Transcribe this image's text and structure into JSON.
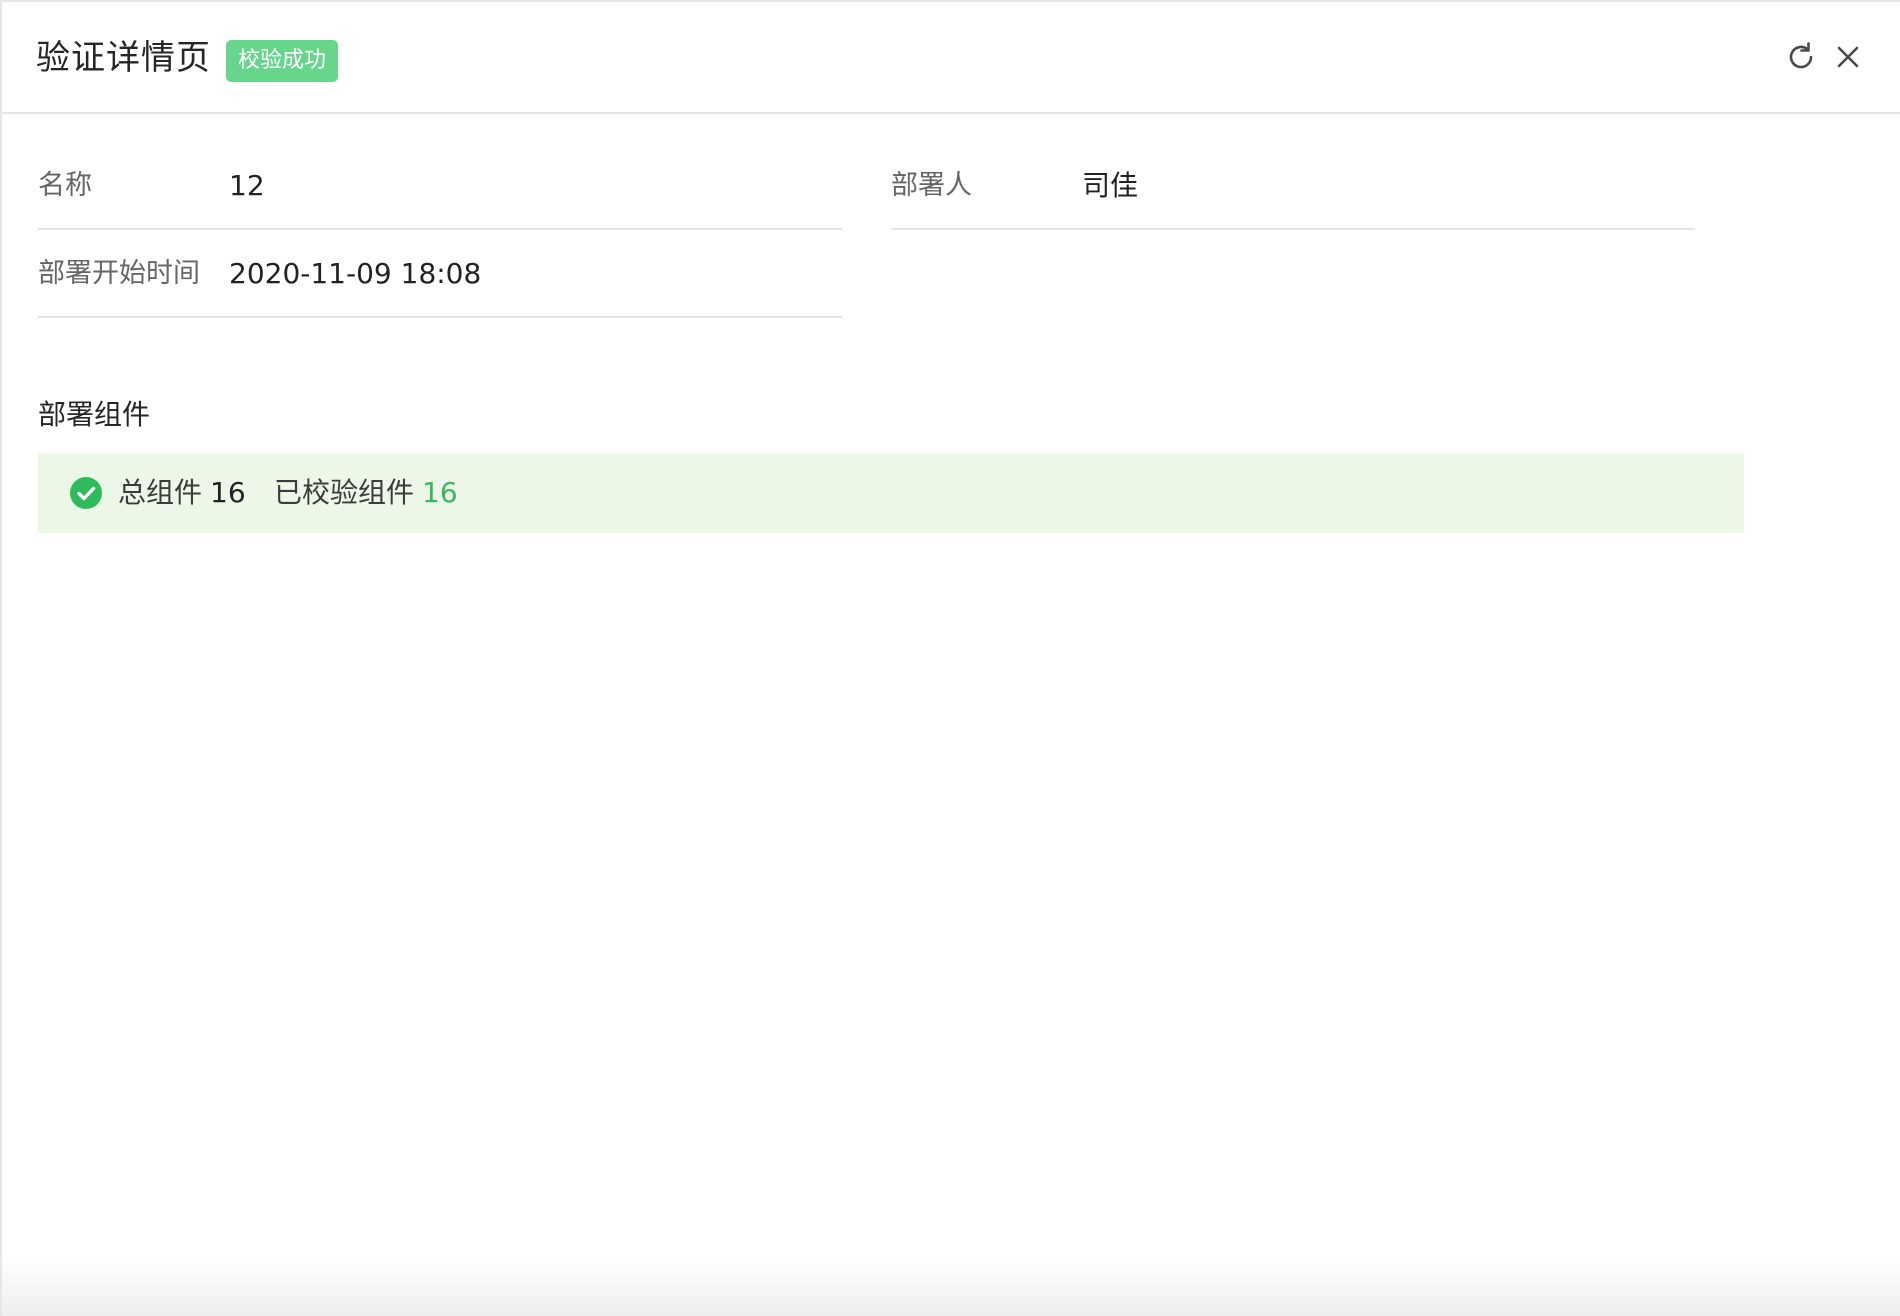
{
  "header": {
    "title": "验证详情页",
    "status_badge": "校验成功",
    "refresh_icon": "refresh-icon",
    "close_icon": "close-icon"
  },
  "fields": {
    "name": {
      "label": "名称",
      "value": "12"
    },
    "deployer": {
      "label": "部署人",
      "value": "司佳"
    },
    "start_time": {
      "label": "部署开始时间",
      "value": "2020-11-09 18:08"
    }
  },
  "components": {
    "section_title": "部署组件",
    "status_icon": "check-circle-icon",
    "total_label": "总组件",
    "total_count": "16",
    "verified_label": "已校验组件",
    "verified_count": "16"
  },
  "colors": {
    "badge_bg": "#67d68c",
    "success_green": "#3cb760",
    "summary_bg": "#edf7e8"
  }
}
